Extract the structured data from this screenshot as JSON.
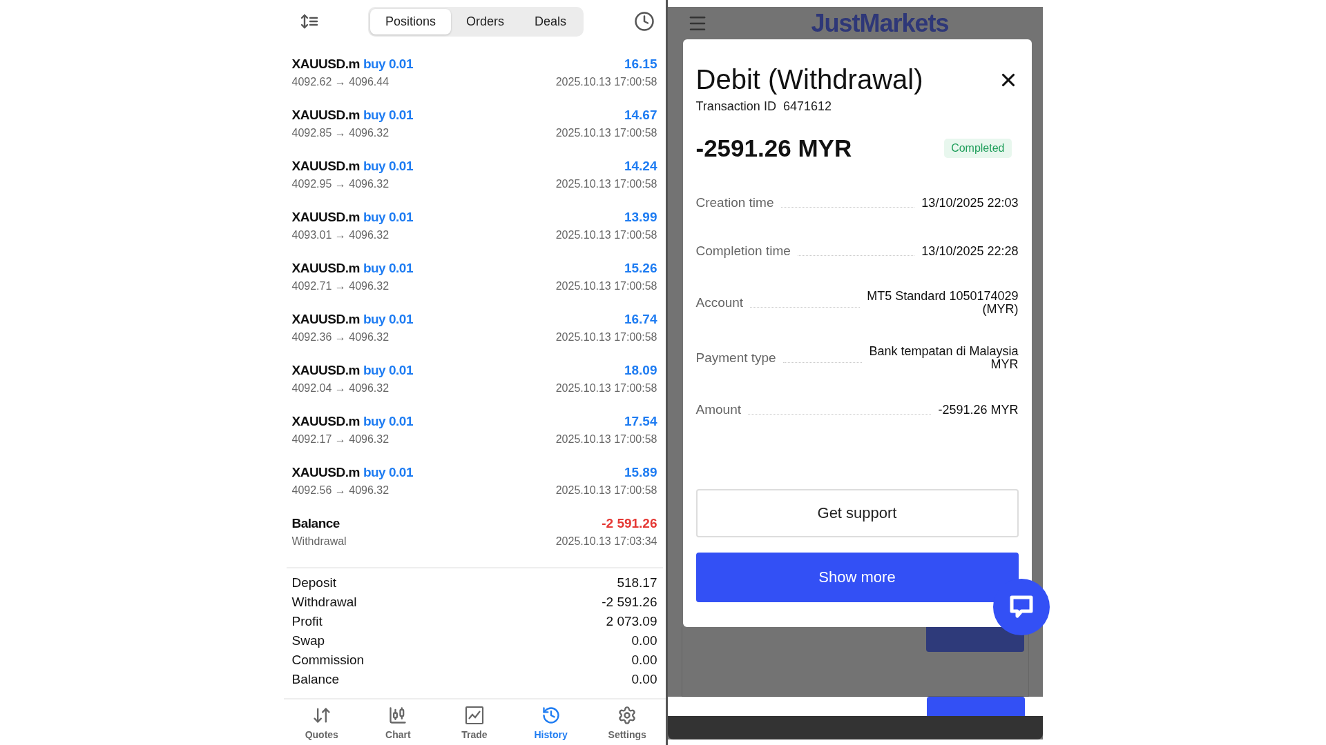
{
  "tabs": [
    {
      "label": "Positions",
      "selected": true
    },
    {
      "label": "Orders",
      "selected": false
    },
    {
      "label": "Deals",
      "selected": false
    }
  ],
  "deals": [
    {
      "kind": "trade",
      "symbol": "XAUUSD.m",
      "side": "buy 0.01",
      "prices": "4092.62 → 4096.44",
      "profit": "16.15",
      "time": "2025.10.13 17:00:58"
    },
    {
      "kind": "trade",
      "symbol": "XAUUSD.m",
      "side": "buy 0.01",
      "prices": "4092.85 → 4096.32",
      "profit": "14.67",
      "time": "2025.10.13 17:00:58"
    },
    {
      "kind": "trade",
      "symbol": "XAUUSD.m",
      "side": "buy 0.01",
      "prices": "4092.95 → 4096.32",
      "profit": "14.24",
      "time": "2025.10.13 17:00:58"
    },
    {
      "kind": "trade",
      "symbol": "XAUUSD.m",
      "side": "buy 0.01",
      "prices": "4093.01 → 4096.32",
      "profit": "13.99",
      "time": "2025.10.13 17:00:58"
    },
    {
      "kind": "trade",
      "symbol": "XAUUSD.m",
      "side": "buy 0.01",
      "prices": "4092.71 → 4096.32",
      "profit": "15.26",
      "time": "2025.10.13 17:00:58"
    },
    {
      "kind": "trade",
      "symbol": "XAUUSD.m",
      "side": "buy 0.01",
      "prices": "4092.36 → 4096.32",
      "profit": "16.74",
      "time": "2025.10.13 17:00:58"
    },
    {
      "kind": "trade",
      "symbol": "XAUUSD.m",
      "side": "buy 0.01",
      "prices": "4092.04 → 4096.32",
      "profit": "18.09",
      "time": "2025.10.13 17:00:58"
    },
    {
      "kind": "trade",
      "symbol": "XAUUSD.m",
      "side": "buy 0.01",
      "prices": "4092.17 → 4096.32",
      "profit": "17.54",
      "time": "2025.10.13 17:00:58"
    },
    {
      "kind": "trade",
      "symbol": "XAUUSD.m",
      "side": "buy 0.01",
      "prices": "4092.56 → 4096.32",
      "profit": "15.89",
      "time": "2025.10.13 17:00:58"
    },
    {
      "kind": "balance",
      "symbol": "Balance",
      "prices": "Withdrawal",
      "profit": "-2 591.26",
      "time": "2025.10.13 17:03:34"
    }
  ],
  "summary": [
    {
      "label": "Deposit",
      "value": "518.17"
    },
    {
      "label": "Withdrawal",
      "value": "-2 591.26"
    },
    {
      "label": "Profit",
      "value": "2 073.09"
    },
    {
      "label": "Swap",
      "value": "0.00"
    },
    {
      "label": "Commission",
      "value": "0.00"
    },
    {
      "label": "Balance",
      "value": "0.00"
    }
  ],
  "nav": [
    {
      "kind": "quotes",
      "label": "Quotes",
      "selected": false
    },
    {
      "kind": "chart",
      "label": "Chart",
      "selected": false
    },
    {
      "kind": "trade",
      "label": "Trade",
      "selected": false
    },
    {
      "kind": "history",
      "label": "History",
      "selected": true
    },
    {
      "kind": "settings",
      "label": "Settings",
      "selected": false
    }
  ],
  "site": {
    "logo": "JustMarkets"
  },
  "dialog": {
    "title": "Debit (Withdrawal)",
    "transaction_label": "Transaction ID",
    "transaction_id": "6471612",
    "amount": "-2591.26 MYR",
    "status": "Completed",
    "details": [
      {
        "label": "Creation time",
        "value": [
          "13/10/2025 22:03"
        ]
      },
      {
        "label": "Completion time",
        "value": [
          "13/10/2025 22:28"
        ]
      },
      {
        "label": "Account",
        "value": [
          "MT5 Standard 1050174029",
          "(MYR)"
        ]
      },
      {
        "label": "Payment type",
        "value": [
          "Bank tempatan di Malaysia",
          "MYR"
        ]
      },
      {
        "label": "Amount",
        "value": [
          "-2591.26 MYR"
        ]
      }
    ],
    "buttons": [
      {
        "kind": "outline",
        "label": "Get support"
      },
      {
        "kind": "primary",
        "label": "Show more"
      }
    ]
  }
}
